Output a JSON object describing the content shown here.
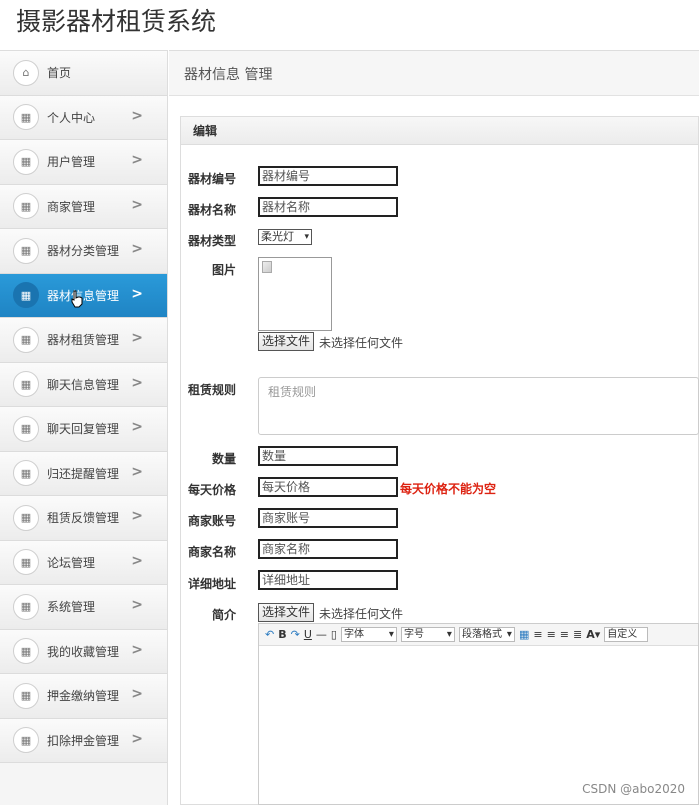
{
  "app_title": "摄影器材租赁系统",
  "breadcrumb": "器材信息 管理",
  "panel_title": "编辑",
  "sidebar": {
    "items": [
      {
        "label": "首页",
        "icon": "home-icon",
        "chevron": ""
      },
      {
        "label": "个人中心",
        "icon": "grid-icon",
        "chevron": ">"
      },
      {
        "label": "用户管理",
        "icon": "grid-icon",
        "chevron": ">"
      },
      {
        "label": "商家管理",
        "icon": "grid-icon",
        "chevron": ">"
      },
      {
        "label": "器材分类管理",
        "icon": "grid-icon",
        "chevron": ">"
      },
      {
        "label": "器材信息管理",
        "icon": "grid-icon",
        "chevron": ">"
      },
      {
        "label": "器材租赁管理",
        "icon": "grid-icon",
        "chevron": ">"
      },
      {
        "label": "聊天信息管理",
        "icon": "grid-icon",
        "chevron": ">"
      },
      {
        "label": "聊天回复管理",
        "icon": "grid-icon",
        "chevron": ">"
      },
      {
        "label": "归还提醒管理",
        "icon": "grid-icon",
        "chevron": ">"
      },
      {
        "label": "租赁反馈管理",
        "icon": "grid-icon",
        "chevron": ">"
      },
      {
        "label": "论坛管理",
        "icon": "grid-icon",
        "chevron": ">"
      },
      {
        "label": "系统管理",
        "icon": "grid-icon",
        "chevron": ">"
      },
      {
        "label": "我的收藏管理",
        "icon": "grid-icon",
        "chevron": ">"
      },
      {
        "label": "押金缴纳管理",
        "icon": "grid-icon",
        "chevron": ">"
      },
      {
        "label": "扣除押金管理",
        "icon": "grid-icon",
        "chevron": ">"
      }
    ],
    "active_index": 5
  },
  "form": {
    "equip_no": {
      "label": "器材编号",
      "value": "器材编号"
    },
    "equip_name": {
      "label": "器材名称",
      "value": "器材名称"
    },
    "equip_type": {
      "label": "器材类型",
      "value": "柔光灯"
    },
    "image": {
      "label": "图片",
      "file_button": "选择文件",
      "file_status": "未选择任何文件"
    },
    "rules": {
      "label": "租赁规则",
      "placeholder": "租赁规则"
    },
    "quantity": {
      "label": "数量",
      "value": "数量"
    },
    "daily_price": {
      "label": "每天价格",
      "value": "每天价格",
      "error": "每天价格不能为空"
    },
    "merchant_account": {
      "label": "商家账号",
      "value": "商家账号"
    },
    "merchant_name": {
      "label": "商家名称",
      "value": "商家名称"
    },
    "address": {
      "label": "详细地址",
      "value": "详细地址"
    },
    "intro": {
      "label": "简介",
      "file_button": "选择文件",
      "file_status": "未选择任何文件"
    }
  },
  "editor_toolbar": {
    "font": "字体",
    "size": "字号",
    "paragraph": "段落格式",
    "custom": "自定义标"
  },
  "watermark": "CSDN @abo2020",
  "colors": {
    "active": "#1f84c4",
    "error": "#dd2211"
  }
}
